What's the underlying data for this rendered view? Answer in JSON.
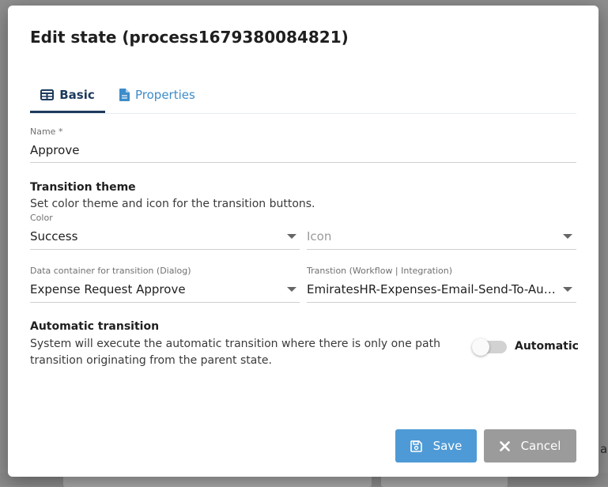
{
  "dialog": {
    "title": "Edit state (process1679380084821)",
    "tabs": [
      {
        "label": "Basic",
        "icon": "table-icon",
        "active": true
      },
      {
        "label": "Properties",
        "icon": "document-icon",
        "active": false
      }
    ]
  },
  "form": {
    "name": {
      "label": "Name *",
      "value": "Approve"
    },
    "transition_theme": {
      "title": "Transition theme",
      "description": "Set color theme and icon for the transition buttons."
    },
    "color": {
      "label": "Color",
      "value": "Success"
    },
    "icon": {
      "placeholder": "Icon"
    },
    "data_container": {
      "label": "Data container for transition (Dialog)",
      "value": "Expense Request Approve"
    },
    "transition": {
      "label": "Transtion (Workflow | Integration)",
      "value": "EmiratesHR-Expenses-Email-Send-To-Auditor"
    },
    "automatic_transition": {
      "title": "Automatic transition",
      "description": "System will execute the automatic transition where there is only one path transition originating from the parent state.",
      "toggle_label": "Automatic",
      "enabled": false
    }
  },
  "footer": {
    "save_label": "Save",
    "cancel_label": "Cancel"
  },
  "background": {
    "partial_text": "ar"
  },
  "colors": {
    "primary": "#4e9ad6",
    "tab_active": "#1d3a5c",
    "tab_link": "#3d8cc9",
    "cancel": "#9b9b9b"
  }
}
